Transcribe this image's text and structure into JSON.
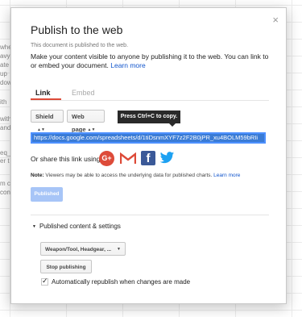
{
  "background": {
    "fragments": [
      "whe",
      "avy",
      "ate",
      "up",
      "dow",
      "ith",
      "with",
      "and",
      "eq_",
      "er t",
      "m ca",
      "con"
    ]
  },
  "dialog": {
    "title": "Publish to the web",
    "close_glyph": "×",
    "status": "This document is published to the web.",
    "description": "Make your content visible to anyone by publishing it to the web. You can link to or embed your document.",
    "learn_more": "Learn more",
    "tabs": [
      "Link",
      "Embed"
    ],
    "selects": {
      "scope": "Shield",
      "format": "Web page"
    },
    "tooltip": "Press Ctrl+C to copy.",
    "url": "https://docs.google.com/spreadsheets/d/1tiDsnmXYF7z2F2B0jPR_xu4BOLM59bRIi",
    "share_label": "Or share this link using:",
    "share_icons": [
      "google-plus-icon",
      "gmail-icon",
      "facebook-icon",
      "twitter-icon"
    ],
    "note_label": "Note:",
    "note_text": "Viewers may be able to access the underlying data for published charts.",
    "note_link": "Learn more",
    "published_button": "Published",
    "section_title": "Published content & settings",
    "content_dropdown": "Weapon/Tool, Headgear, ...",
    "stop_button": "Stop publishing",
    "auto_republish_label": "Automatically republish when changes are made",
    "auto_republish_checked": true
  }
}
